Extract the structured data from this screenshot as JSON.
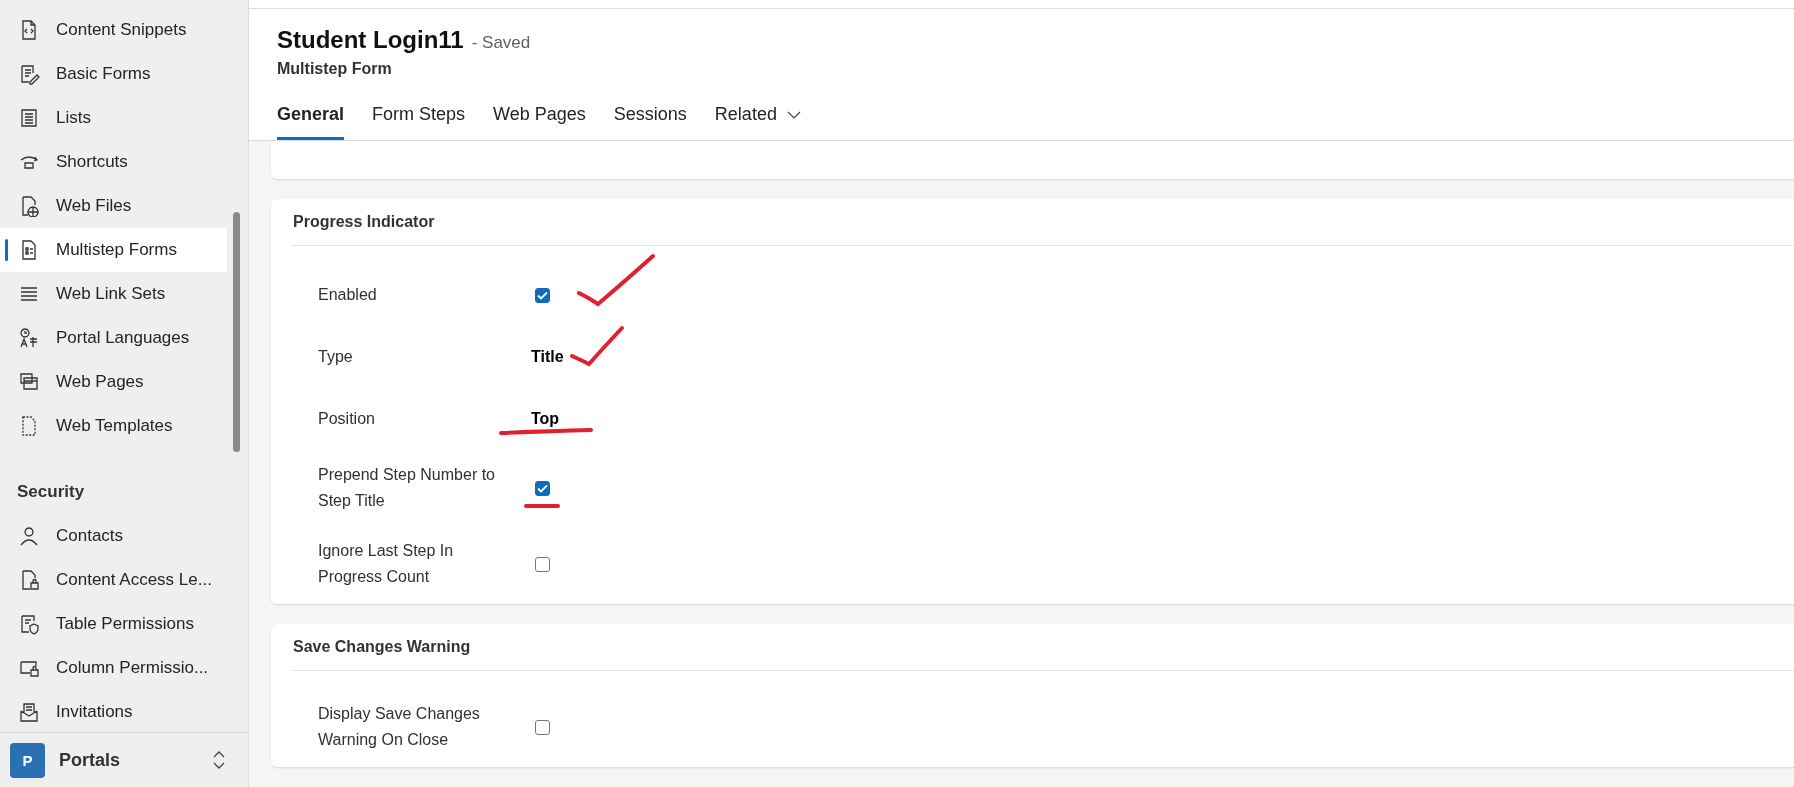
{
  "sidebar": {
    "groups": [
      {
        "items": [
          {
            "label": "Content Snippets",
            "selected": false
          },
          {
            "label": "Basic Forms",
            "selected": false
          },
          {
            "label": "Lists",
            "selected": false
          },
          {
            "label": "Shortcuts",
            "selected": false
          },
          {
            "label": "Web Files",
            "selected": false
          },
          {
            "label": "Multistep Forms",
            "selected": true
          },
          {
            "label": "Web Link Sets",
            "selected": false
          },
          {
            "label": "Portal Languages",
            "selected": false
          },
          {
            "label": "Web Pages",
            "selected": false
          },
          {
            "label": "Web Templates",
            "selected": false
          }
        ]
      },
      {
        "heading": "Security",
        "items": [
          {
            "label": "Contacts",
            "selected": false
          },
          {
            "label": "Content Access Le...",
            "selected": false
          },
          {
            "label": "Table Permissions",
            "selected": false
          },
          {
            "label": "Column Permissio...",
            "selected": false
          },
          {
            "label": "Invitations",
            "selected": false
          }
        ]
      }
    ],
    "footer": {
      "badge": "P",
      "label": "Portals"
    }
  },
  "header": {
    "title": "Student Login11",
    "status": "- Saved",
    "subtitle": "Multistep Form"
  },
  "tabs": [
    {
      "label": "General",
      "selected": true,
      "kind": "tab"
    },
    {
      "label": "Form Steps",
      "selected": false,
      "kind": "tab"
    },
    {
      "label": "Web Pages",
      "selected": false,
      "kind": "tab"
    },
    {
      "label": "Sessions",
      "selected": false,
      "kind": "tab"
    },
    {
      "label": "Related",
      "selected": false,
      "kind": "menu"
    }
  ],
  "sections": [
    {
      "title": "Progress Indicator",
      "fields": [
        {
          "label": "Enabled",
          "kind": "checkbox",
          "checked": true
        },
        {
          "label": "Type",
          "kind": "text",
          "value": "Title"
        },
        {
          "label": "Position",
          "kind": "text",
          "value": "Top"
        },
        {
          "label": "Prepend Step Number to Step Title",
          "kind": "checkbox",
          "checked": true
        },
        {
          "label": "Ignore Last Step In Progress Count",
          "kind": "checkbox",
          "checked": false
        }
      ]
    },
    {
      "title": "Save Changes Warning",
      "fields": [
        {
          "label": "Display Save Changes Warning On Close",
          "kind": "checkbox",
          "checked": false
        }
      ]
    }
  ]
}
